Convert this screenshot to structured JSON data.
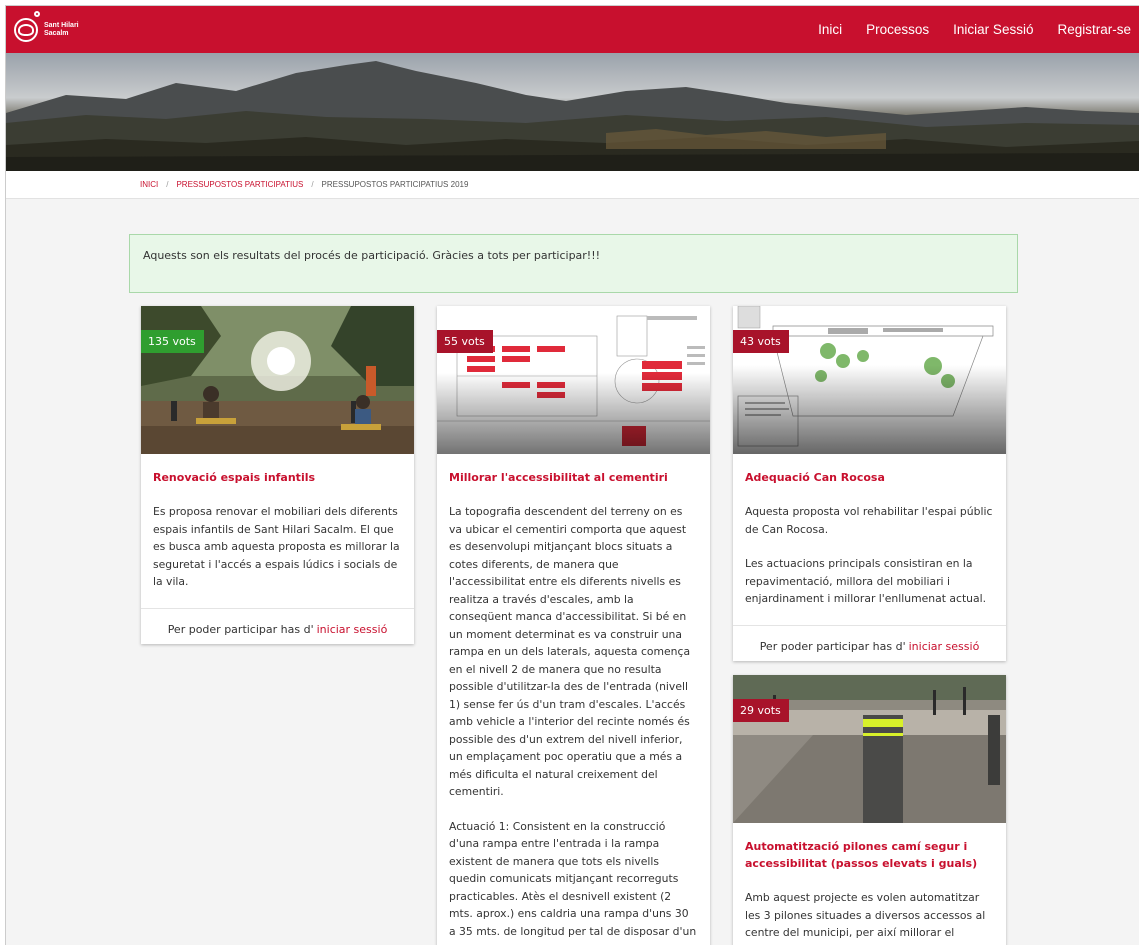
{
  "header": {
    "logo_line1": "Sant Hilari",
    "logo_line2": "Sacalm",
    "nav": [
      "Inici",
      "Processos",
      "Iniciar Sessió",
      "Registrar-se"
    ]
  },
  "breadcrumb": {
    "items": [
      "INICI",
      "PRESSUPOSTOS PARTICIPATIUS"
    ],
    "current": "PRESSUPOSTOS PARTICIPATIUS 2019",
    "separator": "/"
  },
  "notice": "Aquests son els resultats del procés de participació. Gràcies a tots per participar!!!",
  "participate": {
    "prefix": "Per poder participar has d'",
    "link": "iniciar sessió"
  },
  "cards": [
    {
      "votes": "135 vots",
      "title": "Renovació espais infantils",
      "paragraphs": [
        "Es proposa renovar el mobiliari dels diferents espais infantils de Sant Hilari Sacalm. El que es busca amb aquesta proposta es millorar la seguretat i l'accés a espais lúdics i socials de la vila."
      ]
    },
    {
      "votes": "55 vots",
      "title": "Millorar l'accessibilitat al cementiri",
      "paragraphs": [
        "La topografia descendent del terreny on es va ubicar el cementiri comporta que aquest es desenvolupi mitjançant blocs situats a cotes diferents, de manera que l'accessibilitat entre els diferents nivells es realitza a través d'escales, amb la conseqüent manca d'accessibilitat. Si bé en un moment determinat es va construir una rampa en un dels laterals, aquesta comença en el nivell 2 de manera que no resulta possible d'utilitzar-la des de l'entrada (nivell 1) sense fer ús d'un tram d'escales. L'accés amb vehicle a l'interior del recinte només és possible des d'un extrem del nivell inferior, un emplaçament poc operatiu que a més a més dificulta el natural creixement del cementiri.",
        "Actuació 1: Consistent en la construcció d'una rampa entre l'entrada i la rampa existent de manera que tots els nivells quedin comunicats mitjançant recorreguts practicables. Atès el desnivell existent (2 mts. aprox.) ens caldria una rampa d'uns 30 a 35 mts. de longitud per tal de disposar d'un"
      ]
    },
    {
      "votes": "43 vots",
      "title": "Adequació Can Rocosa",
      "paragraphs": [
        "Aquesta proposta vol rehabilitar l'espai públic de Can Rocosa.",
        "Les actuacions principals consistiran en la repavimentació, millora del mobiliari i enjardinament i millorar l'enllumenat actual."
      ]
    },
    {
      "votes": "29 vots",
      "title": "Automatització pilones camí segur i accessibilitat (passos elevats i guals)",
      "paragraphs": [
        "Amb aquest projecte es volen automatitzar les 3 pilones situades a diversos accessos al centre del municipi, per així millorar el"
      ]
    }
  ],
  "colors": {
    "brand": "#c8102e",
    "badge_top": "#2f9e2f",
    "badge_other": "#a8132a",
    "notice_bg": "#e8f7e8"
  }
}
